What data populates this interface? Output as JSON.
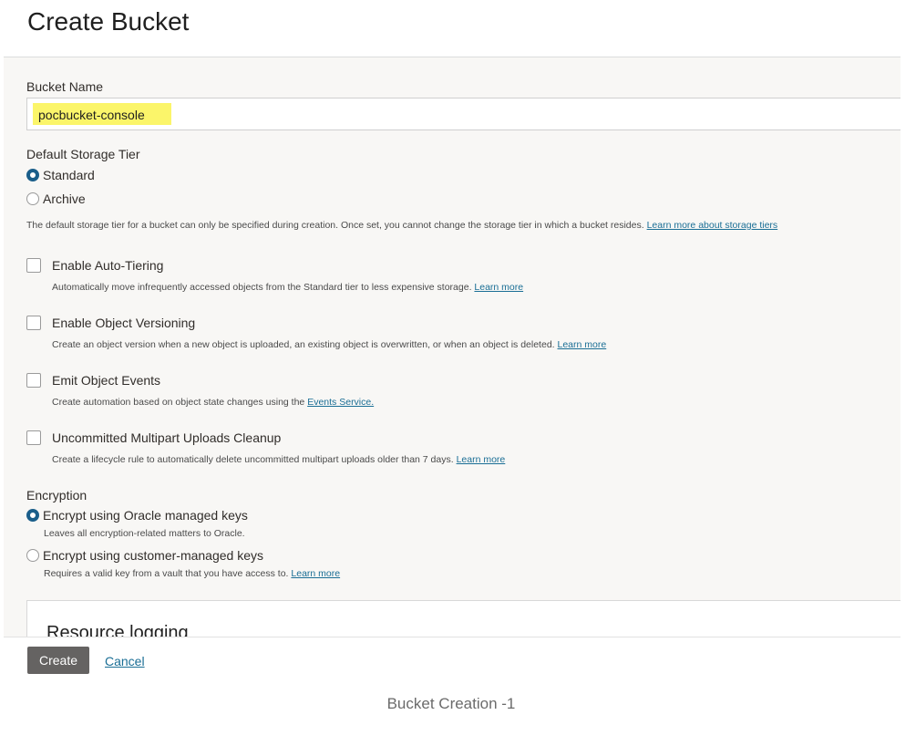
{
  "page": {
    "title": "Create Bucket"
  },
  "bucket_name": {
    "label": "Bucket Name",
    "value": "pocbucket-console"
  },
  "storage_tier": {
    "label": "Default Storage Tier",
    "options": [
      {
        "label": "Standard",
        "selected": true
      },
      {
        "label": "Archive",
        "selected": false
      }
    ],
    "help": "The default storage tier for a bucket can only be specified during creation. Once set, you cannot change the storage tier in which a bucket resides.",
    "help_link": "Learn more about storage tiers"
  },
  "options": [
    {
      "label": "Enable Auto-Tiering",
      "help": "Automatically move infrequently accessed objects from the Standard tier to less expensive storage.",
      "link": "Learn more",
      "checked": false
    },
    {
      "label": "Enable Object Versioning",
      "help": "Create an object version when a new object is uploaded, an existing object is overwritten, or when an object is deleted.",
      "link": "Learn more",
      "checked": false
    },
    {
      "label": "Emit Object Events",
      "help": "Create automation based on object state changes using the",
      "link": "Events Service.",
      "checked": false
    },
    {
      "label": "Uncommitted Multipart Uploads Cleanup",
      "help": "Create a lifecycle rule to automatically delete uncommitted multipart uploads older than 7 days.",
      "link": "Learn more",
      "checked": false
    }
  ],
  "encryption": {
    "label": "Encryption",
    "options": [
      {
        "label": "Encrypt using Oracle managed keys",
        "help": "Leaves all encryption-related matters to Oracle.",
        "link": "",
        "selected": true
      },
      {
        "label": "Encrypt using customer-managed keys",
        "help": "Requires a valid key from a vault that you have access to.",
        "link": "Learn more",
        "selected": false
      }
    ]
  },
  "resource_logging": {
    "title": "Resource logging"
  },
  "footer": {
    "create_label": "Create",
    "cancel_label": "Cancel"
  },
  "caption": "Bucket Creation -1",
  "colors": {
    "accent": "#1a5e8a",
    "link": "#1a6e95",
    "highlight": "#fbf56a",
    "primary_button": "#656362"
  }
}
